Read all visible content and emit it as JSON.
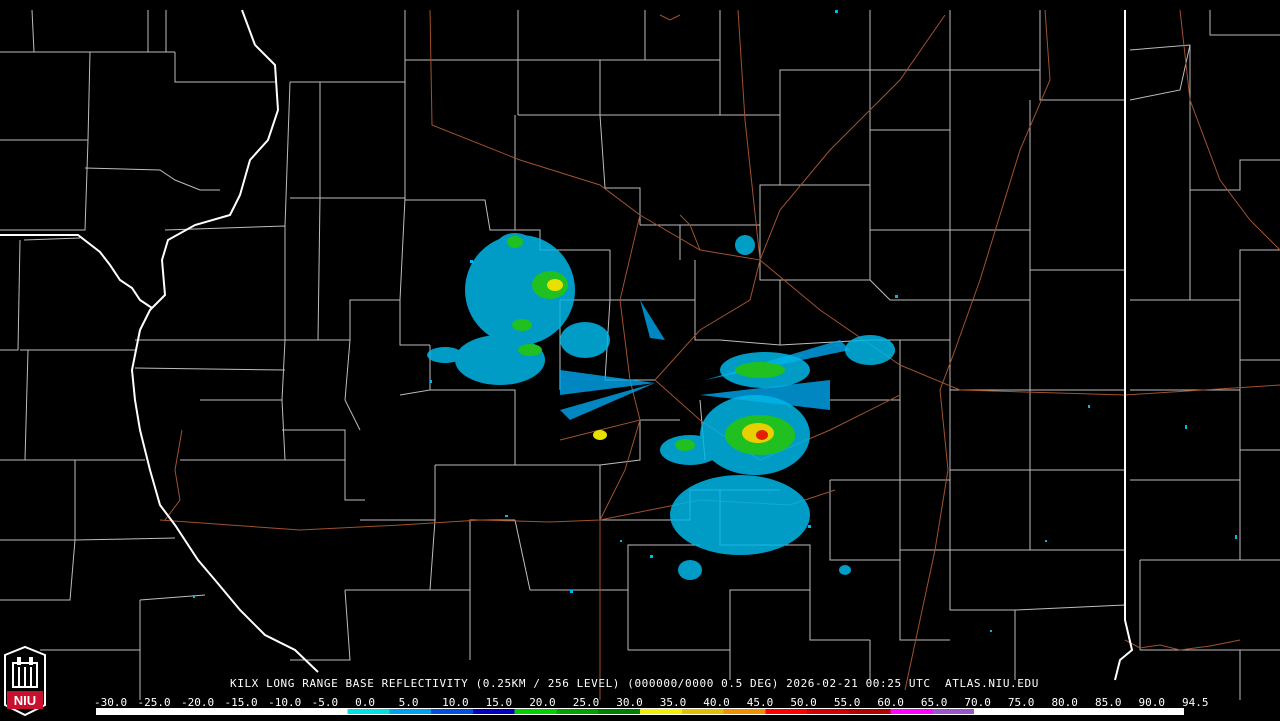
{
  "product": {
    "title": "KILX LONG RANGE BASE REFLECTIVITY (0.25KM / 256 LEVEL) (000000/0000 0.5 DEG) 2026-02-21 00:25 UTC  ATLAS.NIU.EDU",
    "radar_site": "KILX",
    "timestamp": "2026-02-21 00:25 UTC",
    "source": "ATLAS.NIU.EDU"
  },
  "logo": {
    "text": "NIU",
    "color": "#c8102e"
  },
  "color_scale": {
    "labels": [
      "-30.0",
      "-25.0",
      "-20.0",
      "-15.0",
      "-10.0",
      "-5.0",
      "0.0",
      "5.0",
      "10.0",
      "15.0",
      "20.0",
      "25.0",
      "30.0",
      "35.0",
      "40.0",
      "45.0",
      "50.0",
      "55.0",
      "60.0",
      "65.0",
      "70.0",
      "75.0",
      "80.0",
      "85.0",
      "90.0",
      "94.5"
    ],
    "colors": [
      "#ffffff",
      "#ffffff",
      "#ffffff",
      "#ffffff",
      "#ffffff",
      "#ffffff",
      "#00e0e0",
      "#00a0f0",
      "#0050e0",
      "#0000c0",
      "#00d000",
      "#00a000",
      "#008000",
      "#f0f000",
      "#e0c000",
      "#f09000",
      "#ff0000",
      "#d00000",
      "#b00000",
      "#ff00ff",
      "#9955cc",
      "#ffffff",
      "#ffffff",
      "#ffffff",
      "#ffffff",
      "#ffffff"
    ]
  },
  "map_colors": {
    "background": "#000000",
    "county_lines": "#c8c8c8",
    "state_lines": "#ffffff",
    "highways": "#a0522d"
  }
}
